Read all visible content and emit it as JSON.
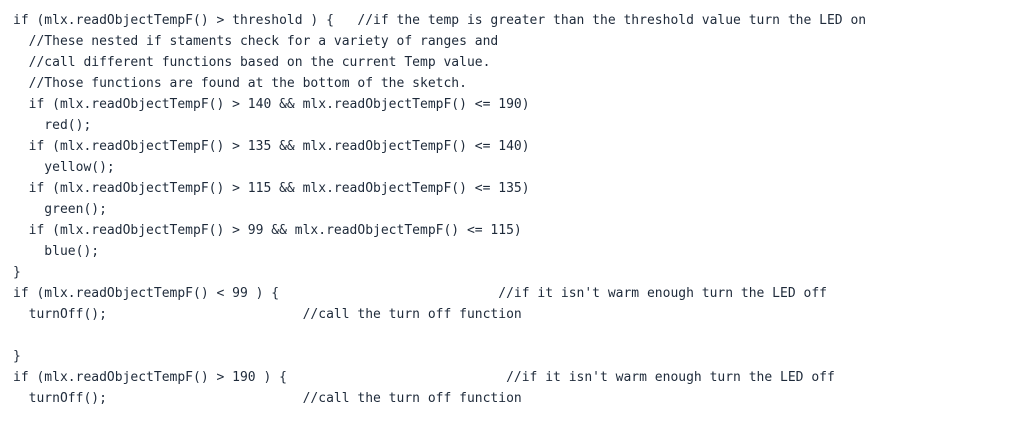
{
  "code_lines": [
    "if (mlx.readObjectTempF() > threshold ) {   //if the temp is greater than the threshold value turn the LED on",
    "  //These nested if staments check for a variety of ranges and",
    "  //call different functions based on the current Temp value.",
    "  //Those functions are found at the bottom of the sketch.",
    "  if (mlx.readObjectTempF() > 140 && mlx.readObjectTempF() <= 190)",
    "    red();",
    "  if (mlx.readObjectTempF() > 135 && mlx.readObjectTempF() <= 140)",
    "    yellow();",
    "  if (mlx.readObjectTempF() > 115 && mlx.readObjectTempF() <= 135)",
    "    green();",
    "  if (mlx.readObjectTempF() > 99 && mlx.readObjectTempF() <= 115)",
    "    blue();",
    "}",
    "if (mlx.readObjectTempF() < 99 ) {                            //if it isn't warm enough turn the LED off",
    "  turnOff();                         //call the turn off function",
    "",
    "}",
    "if (mlx.readObjectTempF() > 190 ) {                            //if it isn't warm enough turn the LED off",
    "  turnOff();                         //call the turn off function"
  ]
}
